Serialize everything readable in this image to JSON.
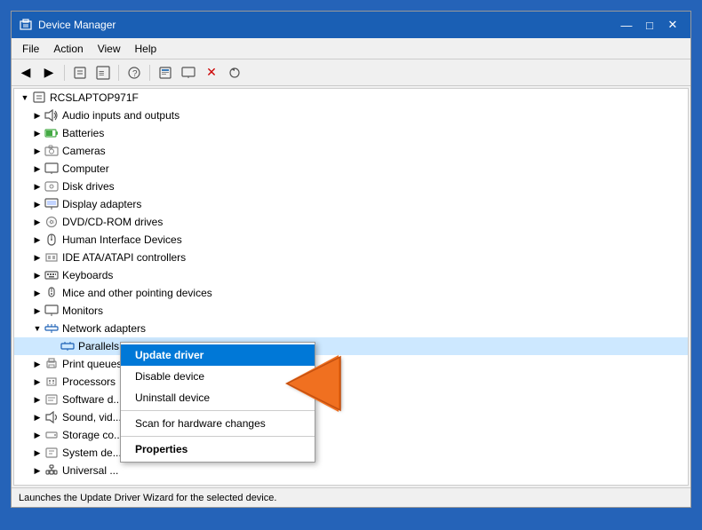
{
  "window": {
    "title": "Device Manager",
    "icon": "⚙"
  },
  "titlebar": {
    "minimize": "—",
    "maximize": "□",
    "close": "✕"
  },
  "menubar": {
    "items": [
      "File",
      "Action",
      "View",
      "Help"
    ]
  },
  "toolbar": {
    "buttons": [
      "←",
      "→",
      "⊡",
      "⊞",
      "?",
      "⊠",
      "🖥",
      "💾",
      "✕",
      "⊕"
    ]
  },
  "tree": {
    "root": "RCSLAPTOP971F",
    "items": [
      {
        "label": "Audio inputs and outputs",
        "indent": 1,
        "icon": "🔊",
        "expanded": false
      },
      {
        "label": "Batteries",
        "indent": 1,
        "icon": "🔋",
        "expanded": false
      },
      {
        "label": "Cameras",
        "indent": 1,
        "icon": "📷",
        "expanded": false
      },
      {
        "label": "Computer",
        "indent": 1,
        "icon": "💻",
        "expanded": false
      },
      {
        "label": "Disk drives",
        "indent": 1,
        "icon": "💿",
        "expanded": false
      },
      {
        "label": "Display adapters",
        "indent": 1,
        "icon": "🖥",
        "expanded": false
      },
      {
        "label": "DVD/CD-ROM drives",
        "indent": 1,
        "icon": "📀",
        "expanded": false
      },
      {
        "label": "Human Interface Devices",
        "indent": 1,
        "icon": "🖱",
        "expanded": false
      },
      {
        "label": "IDE ATA/ATAPI controllers",
        "indent": 1,
        "icon": "⚙",
        "expanded": false
      },
      {
        "label": "Keyboards",
        "indent": 1,
        "icon": "⌨",
        "expanded": false
      },
      {
        "label": "Mice and other pointing devices",
        "indent": 1,
        "icon": "🖱",
        "expanded": false
      },
      {
        "label": "Monitors",
        "indent": 1,
        "icon": "🖥",
        "expanded": false
      },
      {
        "label": "Network adapters",
        "indent": 1,
        "icon": "🌐",
        "expanded": true
      },
      {
        "label": "Parallels Ethernet Adapter",
        "indent": 2,
        "icon": "🌐",
        "expanded": false,
        "selected": true
      },
      {
        "label": "Print queues",
        "indent": 1,
        "icon": "🖨",
        "expanded": false
      },
      {
        "label": "Processors",
        "indent": 1,
        "icon": "⚙",
        "expanded": false
      },
      {
        "label": "Software d...",
        "indent": 1,
        "icon": "📄",
        "expanded": false
      },
      {
        "label": "Sound, vid...",
        "indent": 1,
        "icon": "🔊",
        "expanded": false
      },
      {
        "label": "Storage co...",
        "indent": 1,
        "icon": "💾",
        "expanded": false
      },
      {
        "label": "System de...",
        "indent": 1,
        "icon": "⚙",
        "expanded": false
      },
      {
        "label": "Universal ...",
        "indent": 1,
        "icon": "🔌",
        "expanded": false
      }
    ]
  },
  "contextmenu": {
    "items": [
      {
        "label": "Update driver",
        "type": "active"
      },
      {
        "label": "Disable device",
        "type": "normal"
      },
      {
        "label": "Uninstall device",
        "type": "normal"
      },
      {
        "label": "separator",
        "type": "separator"
      },
      {
        "label": "Scan for hardware changes",
        "type": "normal"
      },
      {
        "label": "separator2",
        "type": "separator"
      },
      {
        "label": "Properties",
        "type": "bold"
      }
    ]
  },
  "statusbar": {
    "text": "Launches the Update Driver Wizard for the selected device."
  }
}
